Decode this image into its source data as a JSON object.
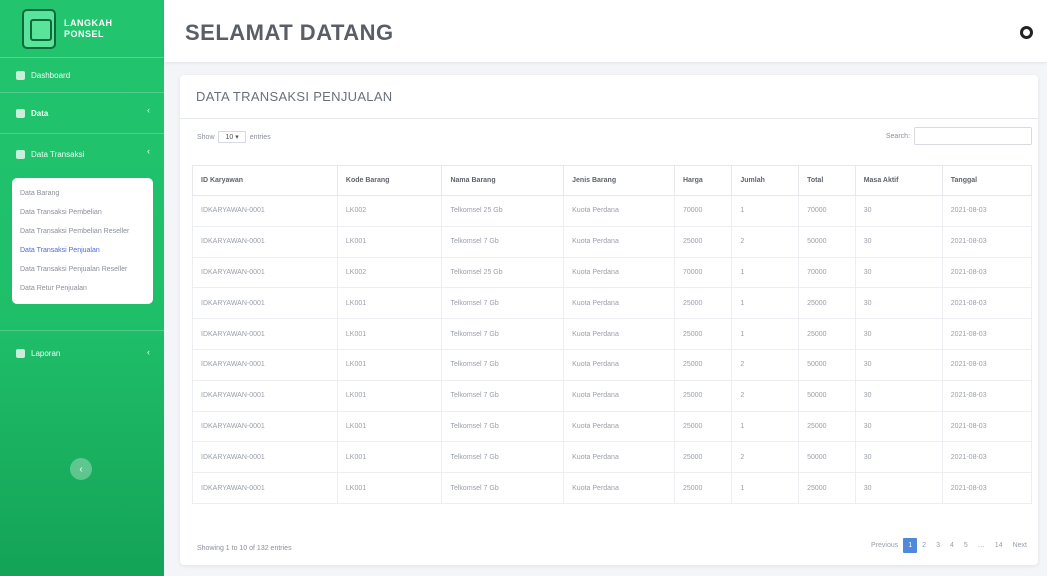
{
  "brand": {
    "line1": "LANGKAH",
    "line2": "PONSEL"
  },
  "sidebar": {
    "dashboard": "Dashboard",
    "data": "Data",
    "transaksi": "Data Transaksi",
    "submenu": [
      "Data Barang",
      "Data Transaksi Pembelian",
      "Data Transaksi Pembelian Reseller",
      "Data Transaksi Penjualan",
      "Data Transaksi Penjualan Reseller",
      "Data Retur Penjualan"
    ],
    "laporan": "Laporan",
    "chev": "‹"
  },
  "topbar": {
    "title": "SELAMAT DATANG"
  },
  "card": {
    "title": "DATA TRANSAKSI PENJUALAN",
    "show_prefix": "Show",
    "show_value": "10",
    "show_suffix": "entries",
    "search_label": "Search:"
  },
  "table": {
    "headers": [
      "ID Karyawan",
      "Kode Barang",
      "Nama Barang",
      "Jenis Barang",
      "Harga",
      "Jumlah",
      "Total",
      "Masa Aktif",
      "Tanggal"
    ],
    "rows": [
      [
        "IDKARYAWAN-0001",
        "LK002",
        "Telkomsel 25 Gb",
        "Kuota Perdana",
        "70000",
        "1",
        "70000",
        "30",
        "2021-08-03"
      ],
      [
        "IDKARYAWAN-0001",
        "LK001",
        "Telkomsel 7 Gb",
        "Kuota Perdana",
        "25000",
        "2",
        "50000",
        "30",
        "2021-08-03"
      ],
      [
        "IDKARYAWAN-0001",
        "LK002",
        "Telkomsel 25 Gb",
        "Kuota Perdana",
        "70000",
        "1",
        "70000",
        "30",
        "2021-08-03"
      ],
      [
        "IDKARYAWAN-0001",
        "LK001",
        "Telkomsel 7 Gb",
        "Kuota Perdana",
        "25000",
        "1",
        "25000",
        "30",
        "2021-08-03"
      ],
      [
        "IDKARYAWAN-0001",
        "LK001",
        "Telkomsel 7 Gb",
        "Kuota Perdana",
        "25000",
        "1",
        "25000",
        "30",
        "2021-08-03"
      ],
      [
        "IDKARYAWAN-0001",
        "LK001",
        "Telkomsel 7 Gb",
        "Kuota Perdana",
        "25000",
        "2",
        "50000",
        "30",
        "2021-08-03"
      ],
      [
        "IDKARYAWAN-0001",
        "LK001",
        "Telkomsel 7 Gb",
        "Kuota Perdana",
        "25000",
        "2",
        "50000",
        "30",
        "2021-08-03"
      ],
      [
        "IDKARYAWAN-0001",
        "LK001",
        "Telkomsel 7 Gb",
        "Kuota Perdana",
        "25000",
        "1",
        "25000",
        "30",
        "2021-08-03"
      ],
      [
        "IDKARYAWAN-0001",
        "LK001",
        "Telkomsel 7 Gb",
        "Kuota Perdana",
        "25000",
        "2",
        "50000",
        "30",
        "2021-08-03"
      ],
      [
        "IDKARYAWAN-0001",
        "LK001",
        "Telkomsel 7 Gb",
        "Kuota Perdana",
        "25000",
        "1",
        "25000",
        "30",
        "2021-08-03"
      ]
    ]
  },
  "footer": {
    "info": "Showing 1 to 10 of 132 entries",
    "pagination": [
      "Previous",
      "1",
      "2",
      "3",
      "4",
      "5",
      "…",
      "14",
      "Next"
    ]
  }
}
